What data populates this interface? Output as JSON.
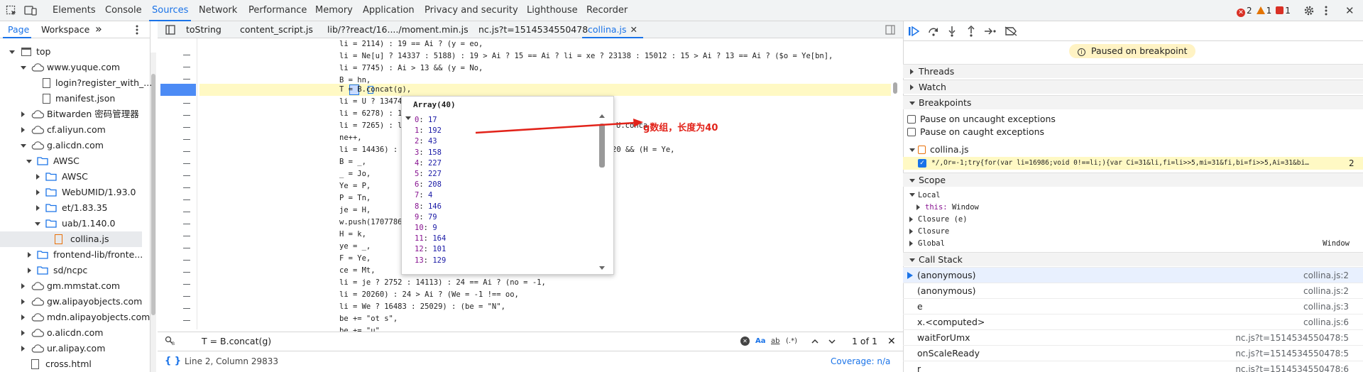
{
  "tabs": [
    "Elements",
    "Console",
    "Sources",
    "Network",
    "Performance",
    "Memory",
    "Application",
    "Privacy and security",
    "Lighthouse",
    "Recorder"
  ],
  "active_tab": "Sources",
  "status_counts": {
    "errors": "2",
    "warnings": "1",
    "issues": "1"
  },
  "nav": {
    "page_tab": "Page",
    "workspace_tab": "Workspace",
    "more": "»"
  },
  "tree": [
    "top",
    "www.yuque.com",
    "login?register_with_...",
    "manifest.json",
    "Bitwarden 密码管理器",
    "cf.aliyun.com",
    "g.alicdn.com",
    "AWSC",
    "AWSC",
    "WebUMID/1.93.0",
    "et/1.83.35",
    "uab/1.140.0",
    "collina.js",
    "frontend-lib/fronte...",
    "sd/ncpc",
    "gm.mmstat.com",
    "gw.alipayobjects.com",
    "mdn.alipayobjects.com",
    "o.alicdn.com",
    "ur.alipay.com",
    "cross.html"
  ],
  "file_tabs": [
    "toString",
    "content_script.js",
    "lib/??react/16..../moment.min.js",
    "nc.js?t=1514534550478",
    "collina.js"
  ],
  "code": [
    "li = 2114) : 19 == Ai ? (y = eo,",
    "li = Ne[u] ? 14337 : 5188) : 19 > Ai ? 15 == Ai ? li = xe ? 23138 : 15012 : 15 > Ai ? 13 == Ai ? ($o = Ye[bn],",
    "li = 7745) : Ai > 13 && (y = No,",
    "B = hn,",
    "T = B.concat(g),",
    "li = U ? 13474",
    "li = 6278) : 1",
    "li = 7265) : li",
    "ne++,",
    "li = 14436) : 2",
    "B = _,",
    "_ = Jo,",
    "Ye = P,",
    "P = Tn,",
    "je = H,",
    "w.push(1707786",
    "H = k,",
    "ye = _,",
    "F = Ye,",
    "ce = Mt,",
    "li = je ? 2752 : 14113) : 24 == Ai ? (no = -1,",
    "li = 20260) : 24 > Ai ? (We = -1 !== oo,",
    "li = We ? 16483 : 25029) : (be = \"N\",",
    "be += \"ot s\",",
    "be += \"u\""
  ],
  "code_tail": {
    "concat_tail": "U.conca",
    "tail2": "20 && (H = Ye,"
  },
  "popup": {
    "title": "Array(40)",
    "items": [
      {
        "k": "0",
        "v": "17"
      },
      {
        "k": "1",
        "v": "192"
      },
      {
        "k": "2",
        "v": "43"
      },
      {
        "k": "3",
        "v": "158"
      },
      {
        "k": "4",
        "v": "227"
      },
      {
        "k": "5",
        "v": "227"
      },
      {
        "k": "6",
        "v": "208"
      },
      {
        "k": "7",
        "v": "4"
      },
      {
        "k": "8",
        "v": "146"
      },
      {
        "k": "9",
        "v": "79"
      },
      {
        "k": "10",
        "v": "9"
      },
      {
        "k": "11",
        "v": "164"
      },
      {
        "k": "12",
        "v": "101"
      },
      {
        "k": "13",
        "v": "129"
      }
    ]
  },
  "annotation": "g数组，长度为40",
  "search": {
    "value": "T = B.concat(g)",
    "match_case": "Aa",
    "whole_word": "ab",
    "regex": ".*",
    "result": "1 of 1"
  },
  "status": {
    "position": "Line 2, Column 29833",
    "coverage": "Coverage: n/a"
  },
  "debugger": {
    "paused": "Paused on breakpoint",
    "threads": "Threads",
    "watch": "Watch",
    "breakpoints": "Breakpoints",
    "pause_uncaught": "Pause on uncaught exceptions",
    "pause_caught": "Pause on caught exceptions",
    "bp_file": "collina.js",
    "bp_code": "*/,Or=-1;try{for(var li=16986;void 0!==li;){var Ci=31&li,fi=li>>5,mi=31&fi,bi=fi>>5,Ai=31&bi…",
    "bp_line": "2",
    "scope": "Scope",
    "local": "Local",
    "this_label": "this:",
    "this_value": "Window",
    "closure_e": "Closure (e)",
    "closure": "Closure",
    "global": "Global",
    "global_value": "Window",
    "call_stack": "Call Stack",
    "stack": [
      {
        "fn": "(anonymous)",
        "loc": "collina.js:2"
      },
      {
        "fn": "(anonymous)",
        "loc": "collina.js:2"
      },
      {
        "fn": "e",
        "loc": "collina.js:3"
      },
      {
        "fn": "x.<computed>",
        "loc": "collina.js:6"
      },
      {
        "fn": "waitForUmx",
        "loc": "nc.js?t=1514534550478:5"
      },
      {
        "fn": "onScaleReady",
        "loc": "nc.js?t=1514534550478:5"
      },
      {
        "fn": "r",
        "loc": "nc.js?t=1514534550478:6"
      }
    ]
  },
  "colors": {
    "accent": "#1a73e8",
    "highlight": "#fff9c4",
    "error": "#d93025",
    "warning": "#e37400",
    "annotation": "#e2231a"
  }
}
